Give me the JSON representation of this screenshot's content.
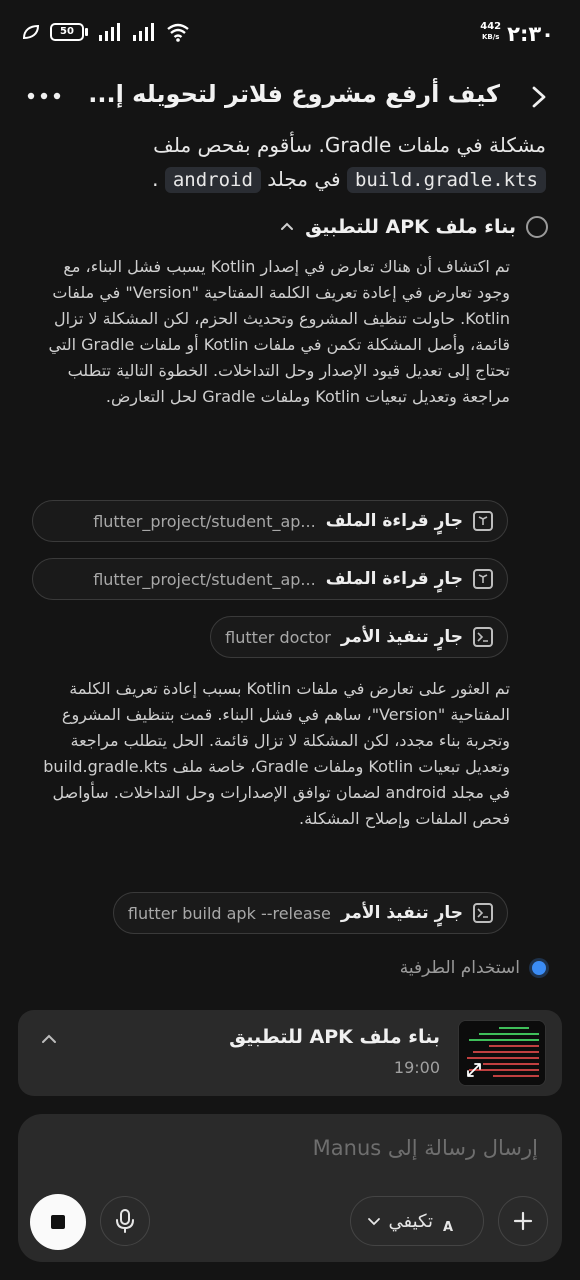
{
  "status_bar": {
    "time": "٢:٣٠",
    "net_speed": "442",
    "net_unit": "KB/s",
    "battery": "50"
  },
  "header": {
    "title": "كيف أرفع مشروع فلاتر لتحويله إ..."
  },
  "intro": {
    "line1": "مشكلة في ملفات Gradle. سأقوم بفحص ملف",
    "code1": "build.gradle.kts",
    "middle": " في مجلد ",
    "code2": "android",
    "end": " ."
  },
  "task": {
    "title": "بناء ملف APK للتطبيق"
  },
  "paragraphs": {
    "p1": "تم اكتشاف أن هناك تعارض في إصدار Kotlin يسبب فشل البناء، مع وجود تعارض في إعادة تعريف الكلمة المفتاحية \"Version\" في ملفات Kotlin. حاولت تنظيف المشروع وتحديث الحزم، لكن المشكلة لا تزال قائمة، وأصل المشكلة تكمن في ملفات Kotlin أو ملفات Gradle التي تحتاج إلى تعديل قيود الإصدار وحل التداخلات. الخطوة التالية تتطلب مراجعة وتعديل تبعيات Kotlin وملفات Gradle لحل التعارض.",
    "p2": "تم العثور على تعارض في ملفات Kotlin بسبب إعادة تعريف الكلمة المفتاحية \"Version\"، ساهم في فشل البناء. قمت بتنظيف المشروع وتجربة بناء مجدد، لكن المشكلة لا تزال قائمة. الحل يتطلب مراجعة وتعديل تبعيات Kotlin وملفات Gradle، خاصة ملف build.gradle.kts في مجلد android لضمان توافق الإصدارات وحل التداخلات. سأواصل فحص الملفات وإصلاح المشكلة."
  },
  "steps": [
    {
      "label": "جارٍ قراءة الملف",
      "arg": "flutter_project/student_ap...",
      "icon": "book-icon"
    },
    {
      "label": "جارٍ قراءة الملف",
      "arg": "flutter_project/student_ap...",
      "icon": "book-icon"
    },
    {
      "label": "جارٍ تنفيذ الأمر",
      "arg": "flutter doctor",
      "icon": "terminal-icon"
    },
    {
      "label": "جارٍ تنفيذ الأمر",
      "arg": "flutter build apk --release",
      "icon": "terminal-icon"
    }
  ],
  "terminal": {
    "label": "استخدام الطرفية"
  },
  "task_card": {
    "title": "بناء ملف APK للتطبيق",
    "time": "19:00"
  },
  "composer": {
    "placeholder": "إرسال رسالة إلى Manus",
    "adapt_label": "تكيفي"
  },
  "colors": {
    "background": "#141414",
    "card": "#2a2a2a",
    "accent_dot": "#3b8cf5"
  }
}
